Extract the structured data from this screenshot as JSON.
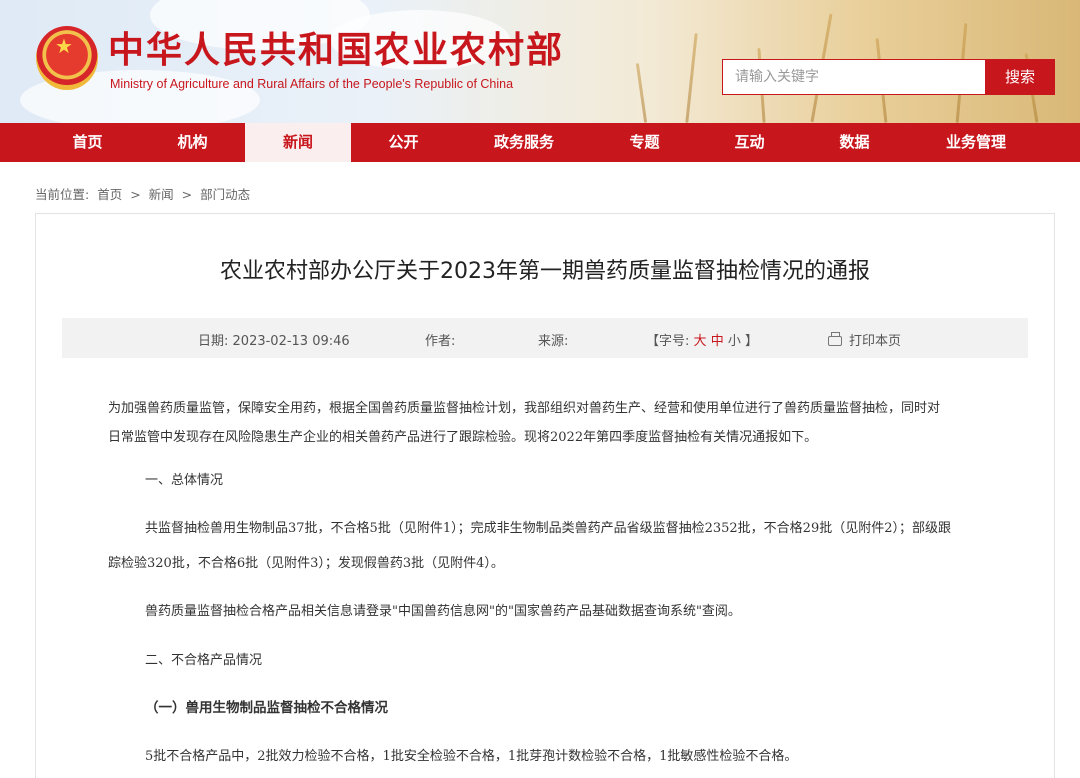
{
  "header": {
    "site_title": "中华人民共和国农业农村部",
    "site_subtitle": "Ministry of Agriculture and Rural Affairs of the People's Republic of China",
    "search_placeholder": "请输入关键字",
    "search_button": "搜索"
  },
  "nav": {
    "items": [
      {
        "label": "首页"
      },
      {
        "label": "机构"
      },
      {
        "label": "新闻",
        "active": true
      },
      {
        "label": "公开"
      },
      {
        "label": "政务服务"
      },
      {
        "label": "专题"
      },
      {
        "label": "互动"
      },
      {
        "label": "数据"
      },
      {
        "label": "业务管理"
      }
    ]
  },
  "breadcrumb": {
    "label": "当前位置:",
    "items": [
      "首页",
      ">",
      "新闻",
      ">",
      "部门动态"
    ]
  },
  "article": {
    "title": "农业农村部办公厅关于2023年第一期兽药质量监督抽检情况的通报",
    "meta": {
      "date_label": "日期:",
      "date_value": "2023-02-13 09:46",
      "author_label": "作者:",
      "author_value": "",
      "source_label": "来源:",
      "source_value": "",
      "font_open": "【字号:",
      "font_large": "大",
      "font_medium": "中",
      "font_small": "小",
      "font_close": "】",
      "print": "打印本页"
    },
    "paragraphs": [
      " 为加强兽药质量监管，保障安全用药，根据全国兽药质量监督抽检计划，我部组织对兽药生产、经营和使用单位进行了兽药质量监督抽检，同时对",
      "日常监管中发现存在风险隐患生产企业的相关兽药产品进行了跟踪检验。现将2022年第四季度监督抽检有关情况通报如下。",
      "一、总体情况",
      "共监督抽检兽用生物制品37批，不合格5批（见附件1）；完成非生物制品类兽药产品省级监督抽检2352批，不合格29批（见附件2）；部级跟",
      "踪检验320批，不合格6批（见附件3）；发现假兽药3批（见附件4）。",
      "兽药质量监督抽检合格产品相关信息请登录\"中国兽药信息网\"的\"国家兽药产品基础数据查询系统\"查阅。",
      "二、不合格产品情况",
      "（一）兽用生物制品监督抽检不合格情况",
      "5批不合格产品中，2批效力检验不合格，1批安全检验不合格，1批芽孢计数检验不合格，1批敏感性检验不合格。"
    ]
  },
  "colors": {
    "brand_red": "#c8161d",
    "nav_active_bg": "#fbeeee",
    "meta_bar_bg": "#f2f2f2"
  }
}
